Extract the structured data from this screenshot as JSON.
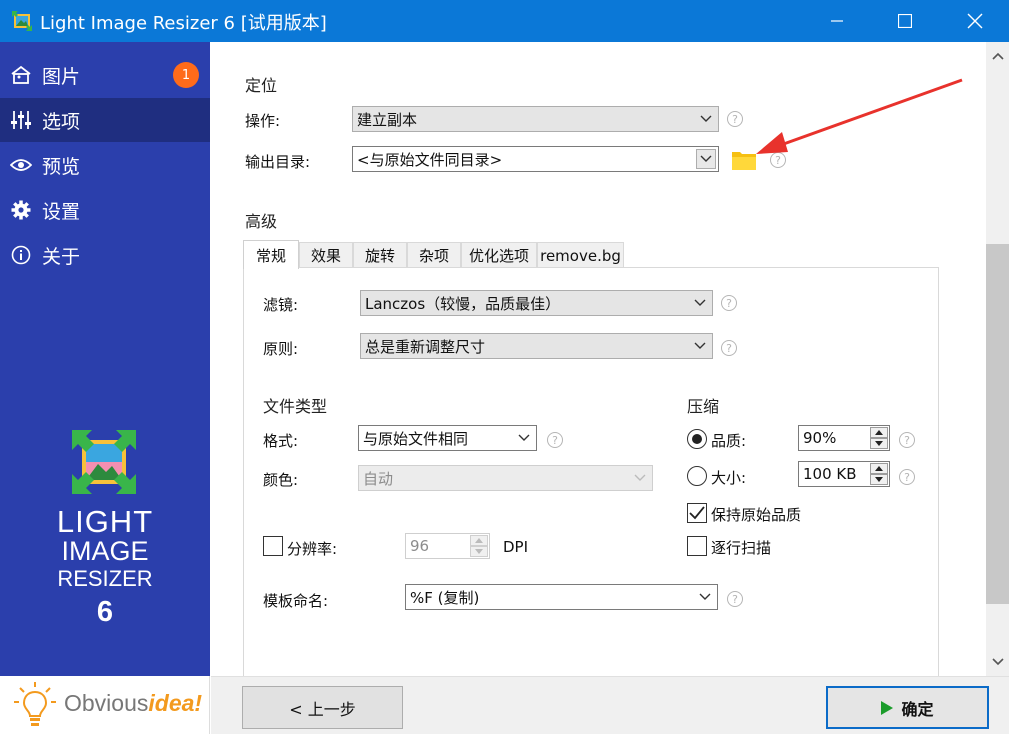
{
  "window": {
    "title": "Light Image Resizer 6  [试用版本]"
  },
  "sidebar": {
    "items": [
      {
        "label": "图片",
        "icon": "image-icon",
        "badge": "1"
      },
      {
        "label": "选项",
        "icon": "sliders-icon"
      },
      {
        "label": "预览",
        "icon": "eye-icon"
      },
      {
        "label": "设置",
        "icon": "gear-icon"
      },
      {
        "label": "关于",
        "icon": "info-icon"
      }
    ],
    "active_index": 1,
    "brand": {
      "line1": "LIGHT",
      "line2": "IMAGE",
      "line3": "RESIZER",
      "line4": "6"
    },
    "vendor": {
      "part1": "Obvious",
      "part2": "idea",
      "suffix": "!"
    }
  },
  "position": {
    "section_title": "定位",
    "operation_label": "操作:",
    "operation_value": "建立副本",
    "output_dir_label": "输出目录:",
    "output_dir_value": "<与原始文件同目录>"
  },
  "advanced": {
    "section_title": "高级",
    "tabs": [
      "常规",
      "效果",
      "旋转",
      "杂项",
      "优化选项",
      "remove.bg"
    ],
    "active_tab": 0,
    "filter_label": "滤镜:",
    "filter_value": "Lanczos（较慢，品质最佳）",
    "rule_label": "原则:",
    "rule_value": "总是重新调整尺寸",
    "file_type_title": "文件类型",
    "format_label": "格式:",
    "format_value": "与原始文件相同",
    "color_label": "颜色:",
    "color_value": "自动",
    "resolution_label": "分辨率:",
    "resolution_value": "96",
    "resolution_unit": "DPI",
    "resolution_checked": false,
    "template_label": "模板命名:",
    "template_value": "%F (复制)",
    "compression_title": "压缩",
    "quality_label": "品质:",
    "quality_value": "90%",
    "size_label": "大小:",
    "size_value": "100 KB",
    "compression_mode": "quality",
    "keep_quality_label": "保持原始品质",
    "keep_quality_checked": true,
    "progressive_label": "逐行扫描",
    "progressive_checked": false
  },
  "footer": {
    "back_label": "< 上一步",
    "ok_label": "确定"
  },
  "colors": {
    "titlebar": "#0b78d7",
    "sidebar": "#2b3fac",
    "sidebar_active": "#1f2e80",
    "badge": "#ff6b1a",
    "primary_border": "#0b6bc8",
    "play_icon": "#1b9c2b",
    "annotation_arrow": "#e8322c"
  }
}
